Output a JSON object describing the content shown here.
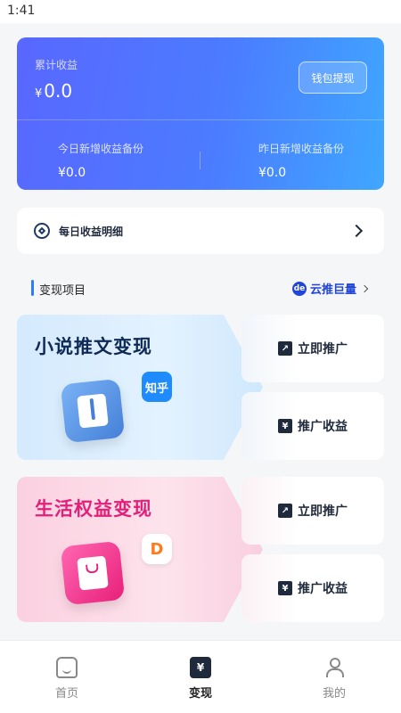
{
  "status_bar": {
    "time": "1:41"
  },
  "earnings": {
    "total_label": "累计收益",
    "currency": "¥",
    "total_value": "0.0",
    "wallet_button": "钱包提现",
    "today_label": "今日新增收益备份",
    "today_value": "¥0.0",
    "yesterday_label": "昨日新增收益备份",
    "yesterday_value": "¥0.0"
  },
  "daily_detail": {
    "label": "每日收益明细"
  },
  "section": {
    "title": "变现项目",
    "link_icon_text": "de",
    "link_label": "云推巨量"
  },
  "projects": [
    {
      "title": "小说推文变现",
      "badge_text": "知乎",
      "promote_label": "立即推广",
      "earnings_label": "推广收益"
    },
    {
      "title": "生活权益变现",
      "badge_text": "D",
      "promote_label": "立即推广",
      "earnings_label": "推广收益"
    }
  ],
  "tabs": [
    {
      "label": "首页",
      "icon": "home-icon"
    },
    {
      "label": "变现",
      "icon": "yen-tab-icon",
      "glyph": "¥"
    },
    {
      "label": "我的",
      "icon": "user-icon"
    }
  ],
  "icons": {
    "chart_glyph": "↗",
    "yen_glyph": "¥"
  }
}
